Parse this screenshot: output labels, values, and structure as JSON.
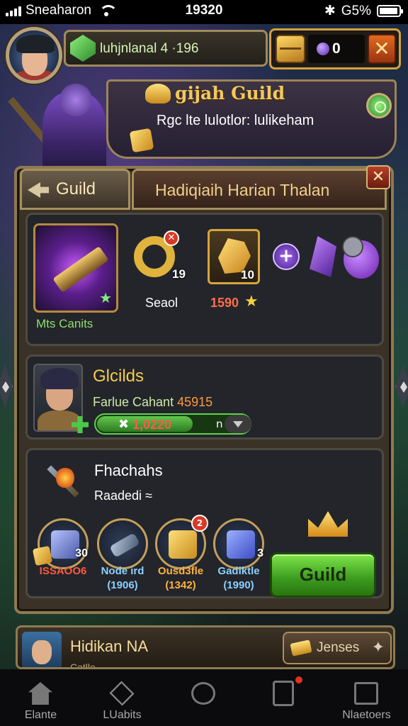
{
  "status_bar": {
    "carrier": "Sneaharon",
    "time": "19320",
    "battery_text": "G5%",
    "battery_level": 0.95
  },
  "hud": {
    "player_name": "luhjnlanal 4 ·196",
    "currency_value": "0"
  },
  "banner": {
    "title": "gijah Guild",
    "subtitle": "Rgc lte lulotlor: lulikeham"
  },
  "tabs": [
    {
      "label": "Guild"
    },
    {
      "label": "Hadiqiaih Harian Thalan"
    }
  ],
  "featured": {
    "weapon_label": "Mts Canits",
    "items": [
      {
        "count": "19",
        "label": "Seaol"
      },
      {
        "count": "10",
        "price": "1590"
      }
    ]
  },
  "guild_card": {
    "title": "Glcilds",
    "subtitle_prefix": "Farlue Cahant",
    "subtitle_value": "45915",
    "progress_text": "1,0220",
    "progress_suffix": "n",
    "progress_fraction": 0.62
  },
  "rewards_section": {
    "title": "Fhachahs",
    "subtitle": "Raadedi ≈",
    "rewards": [
      {
        "count": "30",
        "name": "ISSAOO6",
        "value": ""
      },
      {
        "count": "",
        "name": "Node ird",
        "value": "(1906)"
      },
      {
        "count": "",
        "name": "Ousd3fle",
        "value": "(1342)",
        "notif": "2"
      },
      {
        "count": "3",
        "name": "Gadiktle",
        "value": "(1990)"
      }
    ],
    "button_label": "Guild"
  },
  "player_strip": {
    "name": "Hidikan NA",
    "sub": "Catlle",
    "button_label": "Jenses"
  },
  "nav": [
    {
      "label": "Elante",
      "icon": "home-icon"
    },
    {
      "label": "LUabits",
      "icon": "cube-icon"
    },
    {
      "label": "",
      "icon": "hexagon-icon"
    },
    {
      "label": "",
      "icon": "cards-icon"
    },
    {
      "label": "Nlaetoers",
      "icon": "screen-icon"
    }
  ]
}
